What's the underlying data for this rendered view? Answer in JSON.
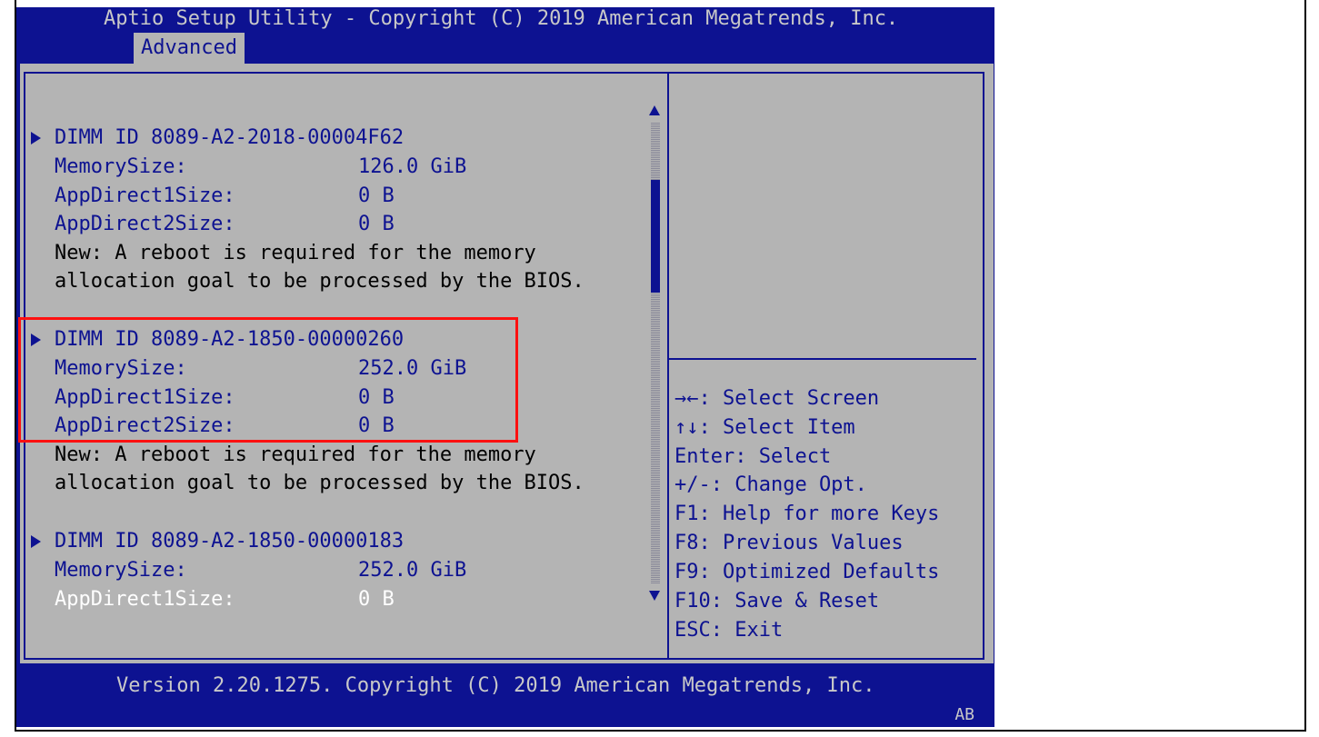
{
  "title": "Aptio Setup Utility - Copyright (C) 2019 American Megatrends, Inc.",
  "tab": "Advanced",
  "dimms": [
    {
      "id": "DIMM ID 8089-A2-2018-00004F62",
      "memory_label": "MemorySize:",
      "memory_value": "126.0 GiB",
      "ad1_label": "AppDirect1Size:",
      "ad1_value": "0 B",
      "ad2_label": "AppDirect2Size:",
      "ad2_value": "0 B",
      "note_line1": "New: A reboot is required for the memory",
      "note_line2": "allocation goal to be processed by the BIOS."
    },
    {
      "id": "DIMM ID 8089-A2-1850-00000260",
      "memory_label": "MemorySize:",
      "memory_value": "252.0 GiB",
      "ad1_label": "AppDirect1Size:",
      "ad1_value": "0 B",
      "ad2_label": "AppDirect2Size:",
      "ad2_value": "0 B",
      "note_line1": "New: A reboot is required for the memory",
      "note_line2": "allocation goal to be processed by the BIOS."
    },
    {
      "id": "DIMM ID 8089-A2-1850-00000183",
      "memory_label": "MemorySize:",
      "memory_value": "252.0 GiB",
      "ad1_label": "AppDirect1Size:",
      "ad1_value": "0 B"
    }
  ],
  "help": [
    "→←: Select Screen",
    "↑↓: Select Item",
    "Enter: Select",
    "+/-: Change Opt.",
    "F1: Help for more Keys",
    "F8: Previous Values",
    "F9: Optimized Defaults",
    "F10: Save & Reset",
    "ESC: Exit"
  ],
  "footer": {
    "version": "Version 2.20.1275. Copyright (C) 2019 American Megatrends, Inc.",
    "ab": "AB"
  },
  "colors": {
    "bios_blue": "#0d1291",
    "panel_gray": "#b4b4b4",
    "highlight_red": "#ff1010"
  }
}
